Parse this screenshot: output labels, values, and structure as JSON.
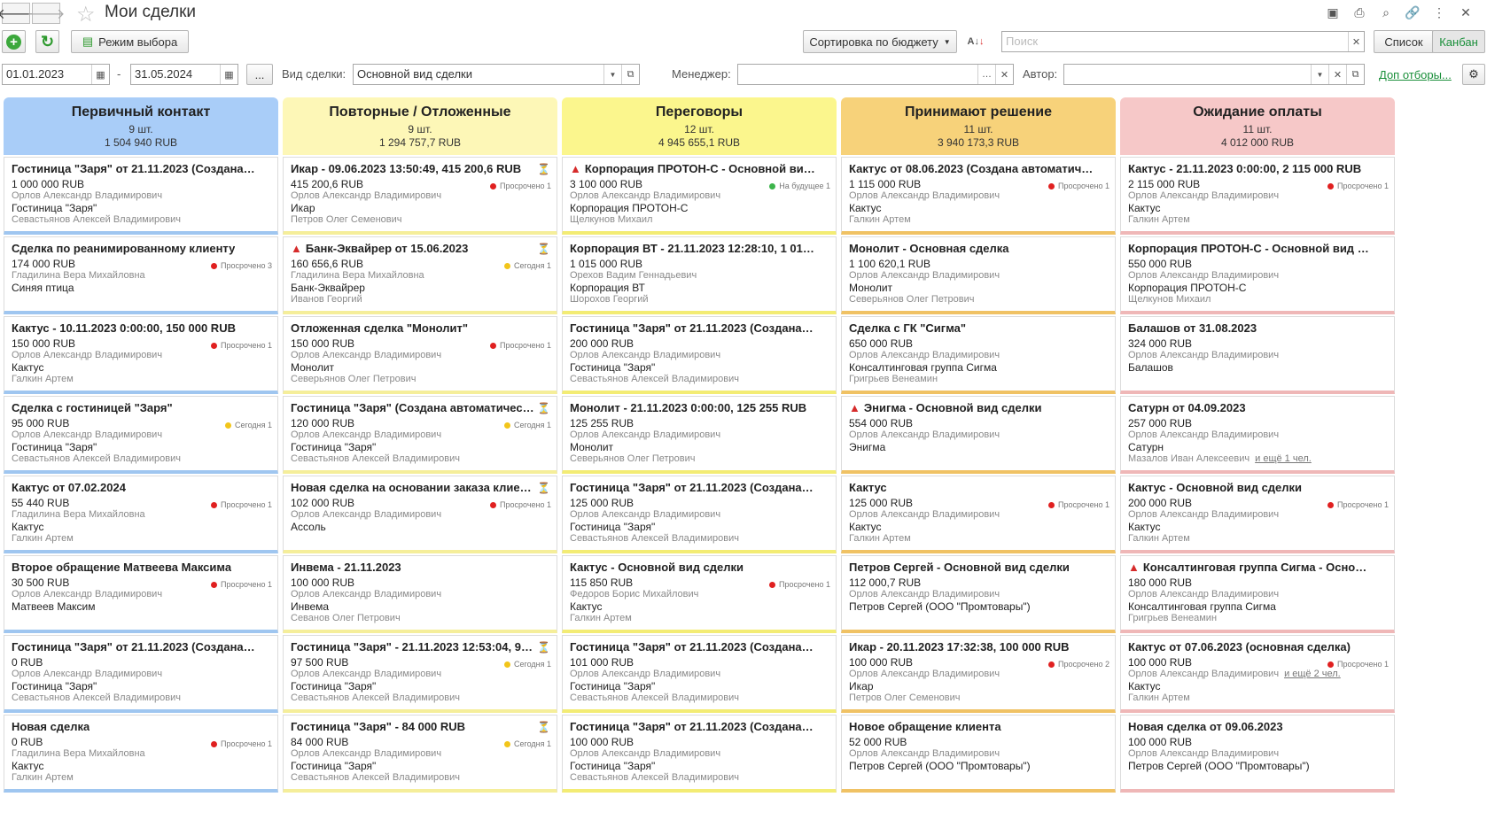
{
  "window": {
    "title": "Мои сделки"
  },
  "toolbar": {
    "mode_button": "Режим выбора",
    "sort_button": "Сортировка по бюджету",
    "search_placeholder": "Поиск",
    "view_list": "Список",
    "view_kanban": "Канбан"
  },
  "filters": {
    "date_from": "01.01.2023",
    "date_sep": "-",
    "date_to": "31.05.2024",
    "dots": "...",
    "deal_type_label": "Вид сделки:",
    "deal_type_value": "Основной вид сделки",
    "manager_label": "Менеджер:",
    "manager_value": "",
    "author_label": "Автор:",
    "author_value": "",
    "more_filters": "Доп отборы..."
  },
  "colors": {
    "blue": "#a9cdf8",
    "yellow": "#fdf7b7",
    "yellow2": "#fbf68d",
    "orange": "#f7d27a",
    "pink": "#f6c8c8",
    "red_dot": "#e02020",
    "yellow_dot": "#f2c51a",
    "green_dot": "#3cb44b",
    "link": "#1a8f3a"
  },
  "columns": [
    {
      "name": "Первичный контакт",
      "count": "9 шт.",
      "sum": "1 504 940 RUB",
      "color": "#a9cdf8",
      "bar": "#9fc6f0",
      "cards": [
        {
          "title": "Гостиница \"Заря\" от 21.11.2023 (Создана авт...",
          "amount": "1 000 000 RUB",
          "manager": "Орлов Александр Владимирович",
          "client": "Гостиница \"Заря\"",
          "author": "Севастьянов Алексей Владимирович"
        },
        {
          "title": "Сделка по реанимированному клиенту",
          "amount": "174 000 RUB",
          "manager": "Гладилина Вера Михайловна",
          "client": "Синяя птица",
          "author": "",
          "status": "Просрочено 3",
          "dot": "red"
        },
        {
          "title": "Кактус - 10.11.2023 0:00:00, 150 000 RUB",
          "amount": "150 000 RUB",
          "manager": "Орлов Александр Владимирович",
          "client": "Кактус",
          "author": "Галкин Артем",
          "status": "Просрочено 1",
          "dot": "red"
        },
        {
          "title": "Сделка с гостиницей \"Заря\"",
          "amount": "95 000 RUB",
          "manager": "Орлов Александр Владимирович",
          "client": "Гостиница \"Заря\"",
          "author": "Севастьянов Алексей Владимирович",
          "status": "Сегодня 1",
          "dot": "yellow"
        },
        {
          "title": "Кактус от 07.02.2024",
          "amount": "55 440 RUB",
          "manager": "Гладилина Вера Михайловна",
          "client": "Кактус",
          "author": "Галкин Артем",
          "status": "Просрочено 1",
          "dot": "red"
        },
        {
          "title": "Второе обращение Матвеева Максима",
          "amount": "30 500 RUB",
          "manager": "Орлов Александр Владимирович",
          "client": "Матвеев Максим",
          "author": "",
          "status": "Просрочено 1",
          "dot": "red"
        },
        {
          "title": "Гостиница \"Заря\" от 21.11.2023 (Создана авт...",
          "amount": "0 RUB",
          "manager": "Орлов Александр Владимирович",
          "client": "Гостиница \"Заря\"",
          "author": "Севастьянов Алексей Владимирович"
        },
        {
          "title": "Новая сделка",
          "amount": "0 RUB",
          "manager": "Гладилина Вера Михайловна",
          "client": "Кактус",
          "author": "Галкин Артем",
          "status": "Просрочено 1",
          "dot": "red"
        }
      ]
    },
    {
      "name": "Повторные / Отложенные",
      "count": "9 шт.",
      "sum": "1 294 757,7 RUB",
      "color": "#fdf7b7",
      "bar": "#f5ee9a",
      "cards": [
        {
          "title": "Икар - 09.06.2023 13:50:49, 415 200,6 RUB",
          "amount": "415 200,6 RUB",
          "manager": "Орлов Александр Владимирович",
          "client": "Икар",
          "author": "Петров Олег Семенович",
          "status": "Просрочено 1",
          "dot": "red",
          "hourglass": true
        },
        {
          "title": "Банк-Эквайрер от 15.06.2023",
          "amount": "160 656,6 RUB",
          "manager": "Гладилина Вера Михайловна",
          "client": "Банк-Эквайрер",
          "author": "Иванов Георгий",
          "status": "Сегодня 1",
          "dot": "yellow",
          "hourglass": true,
          "warn": true
        },
        {
          "title": "Отложенная сделка \"Монолит\"",
          "amount": "150 000 RUB",
          "manager": "Орлов Александр Владимирович",
          "client": "Монолит",
          "author": "Северьянов Олег Петрович",
          "status": "Просрочено 1",
          "dot": "red"
        },
        {
          "title": "Гостиница \"Заря\" (Создана автоматически)",
          "amount": "120 000 RUB",
          "manager": "Орлов Александр Владимирович",
          "client": "Гостиница \"Заря\"",
          "author": "Севастьянов Алексей Владимирович",
          "status": "Сегодня 1",
          "dot": "yellow",
          "hourglass": true
        },
        {
          "title": "Новая сделка на основании заказа клиента",
          "amount": "102 000 RUB",
          "manager": "Орлов Александр Владимирович",
          "client": "Ассоль",
          "author": "",
          "status": "Просрочено 1",
          "dot": "red",
          "hourglass": true
        },
        {
          "title": "Инвема - 21.11.2023",
          "amount": "100 000 RUB",
          "manager": "Орлов Александр Владимирович",
          "client": "Инвема",
          "author": "Севанов Олег Петрович"
        },
        {
          "title": "Гостиница \"Заря\" - 21.11.2023 12:53:04, 97 5...",
          "amount": "97 500 RUB",
          "manager": "Орлов Александр Владимирович",
          "client": "Гостиница \"Заря\"",
          "author": "Севастьянов Алексей Владимирович",
          "status": "Сегодня 1",
          "dot": "yellow",
          "hourglass": true
        },
        {
          "title": "Гостиница \"Заря\" - 84 000 RUB",
          "amount": "84 000 RUB",
          "manager": "Орлов Александр Владимирович",
          "client": "Гостиница \"Заря\"",
          "author": "Севастьянов Алексей Владимирович",
          "status": "Сегодня 1",
          "dot": "yellow",
          "hourglass": true
        }
      ]
    },
    {
      "name": "Переговоры",
      "count": "12 шт.",
      "sum": "4 945 655,1 RUB",
      "color": "#fbf68d",
      "bar": "#f3ec74",
      "cards": [
        {
          "title": "Корпорация ПРОТОН-С - Основной вид сд...",
          "amount": "3 100 000 RUB",
          "manager": "Орлов Александр Владимирович",
          "client": "Корпорация ПРОТОН-С",
          "author": "Щелкунов Михаил",
          "status": "На будущее 1",
          "dot": "green",
          "warn": true
        },
        {
          "title": "Корпорация ВТ - 21.11.2023 12:28:10, 1 015 000...",
          "amount": "1 015 000 RUB",
          "manager": "Орехов Вадим Геннадьевич",
          "client": "Корпорация ВТ",
          "author": "Шорохов Георгий"
        },
        {
          "title": "Гостиница \"Заря\" от 21.11.2023 (Создана авт...",
          "amount": "200 000 RUB",
          "manager": "Орлов Александр Владимирович",
          "client": "Гостиница \"Заря\"",
          "author": "Севастьянов Алексей Владимирович"
        },
        {
          "title": "Монолит - 21.11.2023 0:00:00, 125 255 RUB",
          "amount": "125 255 RUB",
          "manager": "Орлов Александр Владимирович",
          "client": "Монолит",
          "author": "Северьянов Олег Петрович"
        },
        {
          "title": "Гостиница \"Заря\" от 21.11.2023 (Создана авт...",
          "amount": "125 000 RUB",
          "manager": "Орлов Александр Владимирович",
          "client": "Гостиница \"Заря\"",
          "author": "Севастьянов Алексей Владимирович"
        },
        {
          "title": "Кактус - Основной вид сделки",
          "amount": "115 850 RUB",
          "manager": "Федоров Борис Михайлович",
          "client": "Кактус",
          "author": "Галкин Артем",
          "status": "Просрочено 1",
          "dot": "red"
        },
        {
          "title": "Гостиница \"Заря\" от 21.11.2023 (Создана авт...",
          "amount": "101 000 RUB",
          "manager": "Орлов Александр Владимирович",
          "client": "Гостиница \"Заря\"",
          "author": "Севастьянов Алексей Владимирович"
        },
        {
          "title": "Гостиница \"Заря\" от 21.11.2023 (Создана авт...",
          "amount": "100 000 RUB",
          "manager": "Орлов Александр Владимирович",
          "client": "Гостиница \"Заря\"",
          "author": "Севастьянов Алексей Владимирович"
        }
      ]
    },
    {
      "name": "Принимают решение",
      "count": "11 шт.",
      "sum": "3 940 173,3 RUB",
      "color": "#f7d27a",
      "bar": "#f0c264",
      "cards": [
        {
          "title": "Кактус от 08.06.2023 (Создана автоматически)",
          "amount": "1 115 000 RUB",
          "manager": "Орлов Александр Владимирович",
          "client": "Кактус",
          "author": "Галкин Артем",
          "status": "Просрочено 1",
          "dot": "red"
        },
        {
          "title": "Монолит - Основная сделка",
          "amount": "1 100 620,1 RUB",
          "manager": "Орлов Александр Владимирович",
          "client": "Монолит",
          "author": "Северьянов Олег Петрович"
        },
        {
          "title": "Сделка с ГК \"Сигма\"",
          "amount": "650 000 RUB",
          "manager": "Орлов Александр Владимирович",
          "client": "Консалтинговая группа Сигма",
          "author": "Григрьев Венеамин"
        },
        {
          "title": "Энигма - Основной вид сделки",
          "amount": "554 000 RUB",
          "manager": "Орлов Александр Владимирович",
          "client": "Энигма",
          "author": "",
          "warn": true
        },
        {
          "title": "Кактус",
          "amount": "125 000 RUB",
          "manager": "Орлов Александр Владимирович",
          "client": "Кактус",
          "author": "Галкин Артем",
          "status": "Просрочено 1",
          "dot": "red"
        },
        {
          "title": "Петров Сергей - Основной вид сделки",
          "amount": "112 000,7 RUB",
          "manager": "Орлов Александр Владимирович",
          "client": "Петров Сергей (ООО \"Промтовары\")",
          "author": ""
        },
        {
          "title": "Икар - 20.11.2023 17:32:38, 100 000 RUB",
          "amount": "100 000 RUB",
          "manager": "Орлов Александр Владимирович",
          "client": "Икар",
          "author": "Петров Олег Семенович",
          "status": "Просрочено 2",
          "dot": "red"
        },
        {
          "title": "Новое обращение клиента",
          "amount": "52 000 RUB",
          "manager": "Орлов Александр Владимирович",
          "client": "Петров Сергей (ООО \"Промтовары\")",
          "author": ""
        }
      ]
    },
    {
      "name": "Ожидание оплаты",
      "count": "11 шт.",
      "sum": "4 012 000 RUB",
      "color": "#f6c8c8",
      "bar": "#efb7b7",
      "cards": [
        {
          "title": "Кактус - 21.11.2023 0:00:00, 2 115 000 RUB",
          "amount": "2 115 000 RUB",
          "manager": "Орлов Александр Владимирович",
          "client": "Кактус",
          "author": "Галкин Артем",
          "status": "Просрочено 1",
          "dot": "red"
        },
        {
          "title": "Корпорация ПРОТОН-С - Основной вид сделки",
          "amount": "550 000 RUB",
          "manager": "Орлов Александр Владимирович",
          "client": "Корпорация ПРОТОН-С",
          "author": "Щелкунов Михаил"
        },
        {
          "title": "Балашов от 31.08.2023",
          "amount": "324 000 RUB",
          "manager": "Орлов Александр Владимирович",
          "client": "Балашов",
          "author": ""
        },
        {
          "title": "Сатурн от 04.09.2023",
          "amount": "257 000 RUB",
          "manager": "Орлов Александр Владимирович",
          "client": "Сатурн",
          "author": "Мазалов Иван Алексеевич",
          "more": "и ещё 1 чел."
        },
        {
          "title": "Кактус - Основной вид сделки",
          "amount": "200 000 RUB",
          "manager": "Орлов Александр Владимирович",
          "client": "Кактус",
          "author": "Галкин Артем",
          "status": "Просрочено 1",
          "dot": "red"
        },
        {
          "title": "Консалтинговая группа Сигма - Основной...",
          "amount": "180 000 RUB",
          "manager": "Орлов Александр Владимирович",
          "client": "Консалтинговая группа Сигма",
          "author": "Григрьев Венеамин",
          "warn": true
        },
        {
          "title": "Кактус от 07.06.2023 (основная сделка)",
          "amount": "100 000 RUB",
          "manager": "Орлов Александр Владимирович",
          "manager_more": "и ещё 2 чел.",
          "client": "Кактус",
          "author": "Галкин Артем",
          "status": "Просрочено 1",
          "dot": "red"
        },
        {
          "title": "Новая сделка от 09.06.2023",
          "amount": "100 000 RUB",
          "manager": "Орлов Александр Владимирович",
          "client": "Петров Сергей (ООО \"Промтовары\")",
          "author": ""
        }
      ]
    }
  ]
}
